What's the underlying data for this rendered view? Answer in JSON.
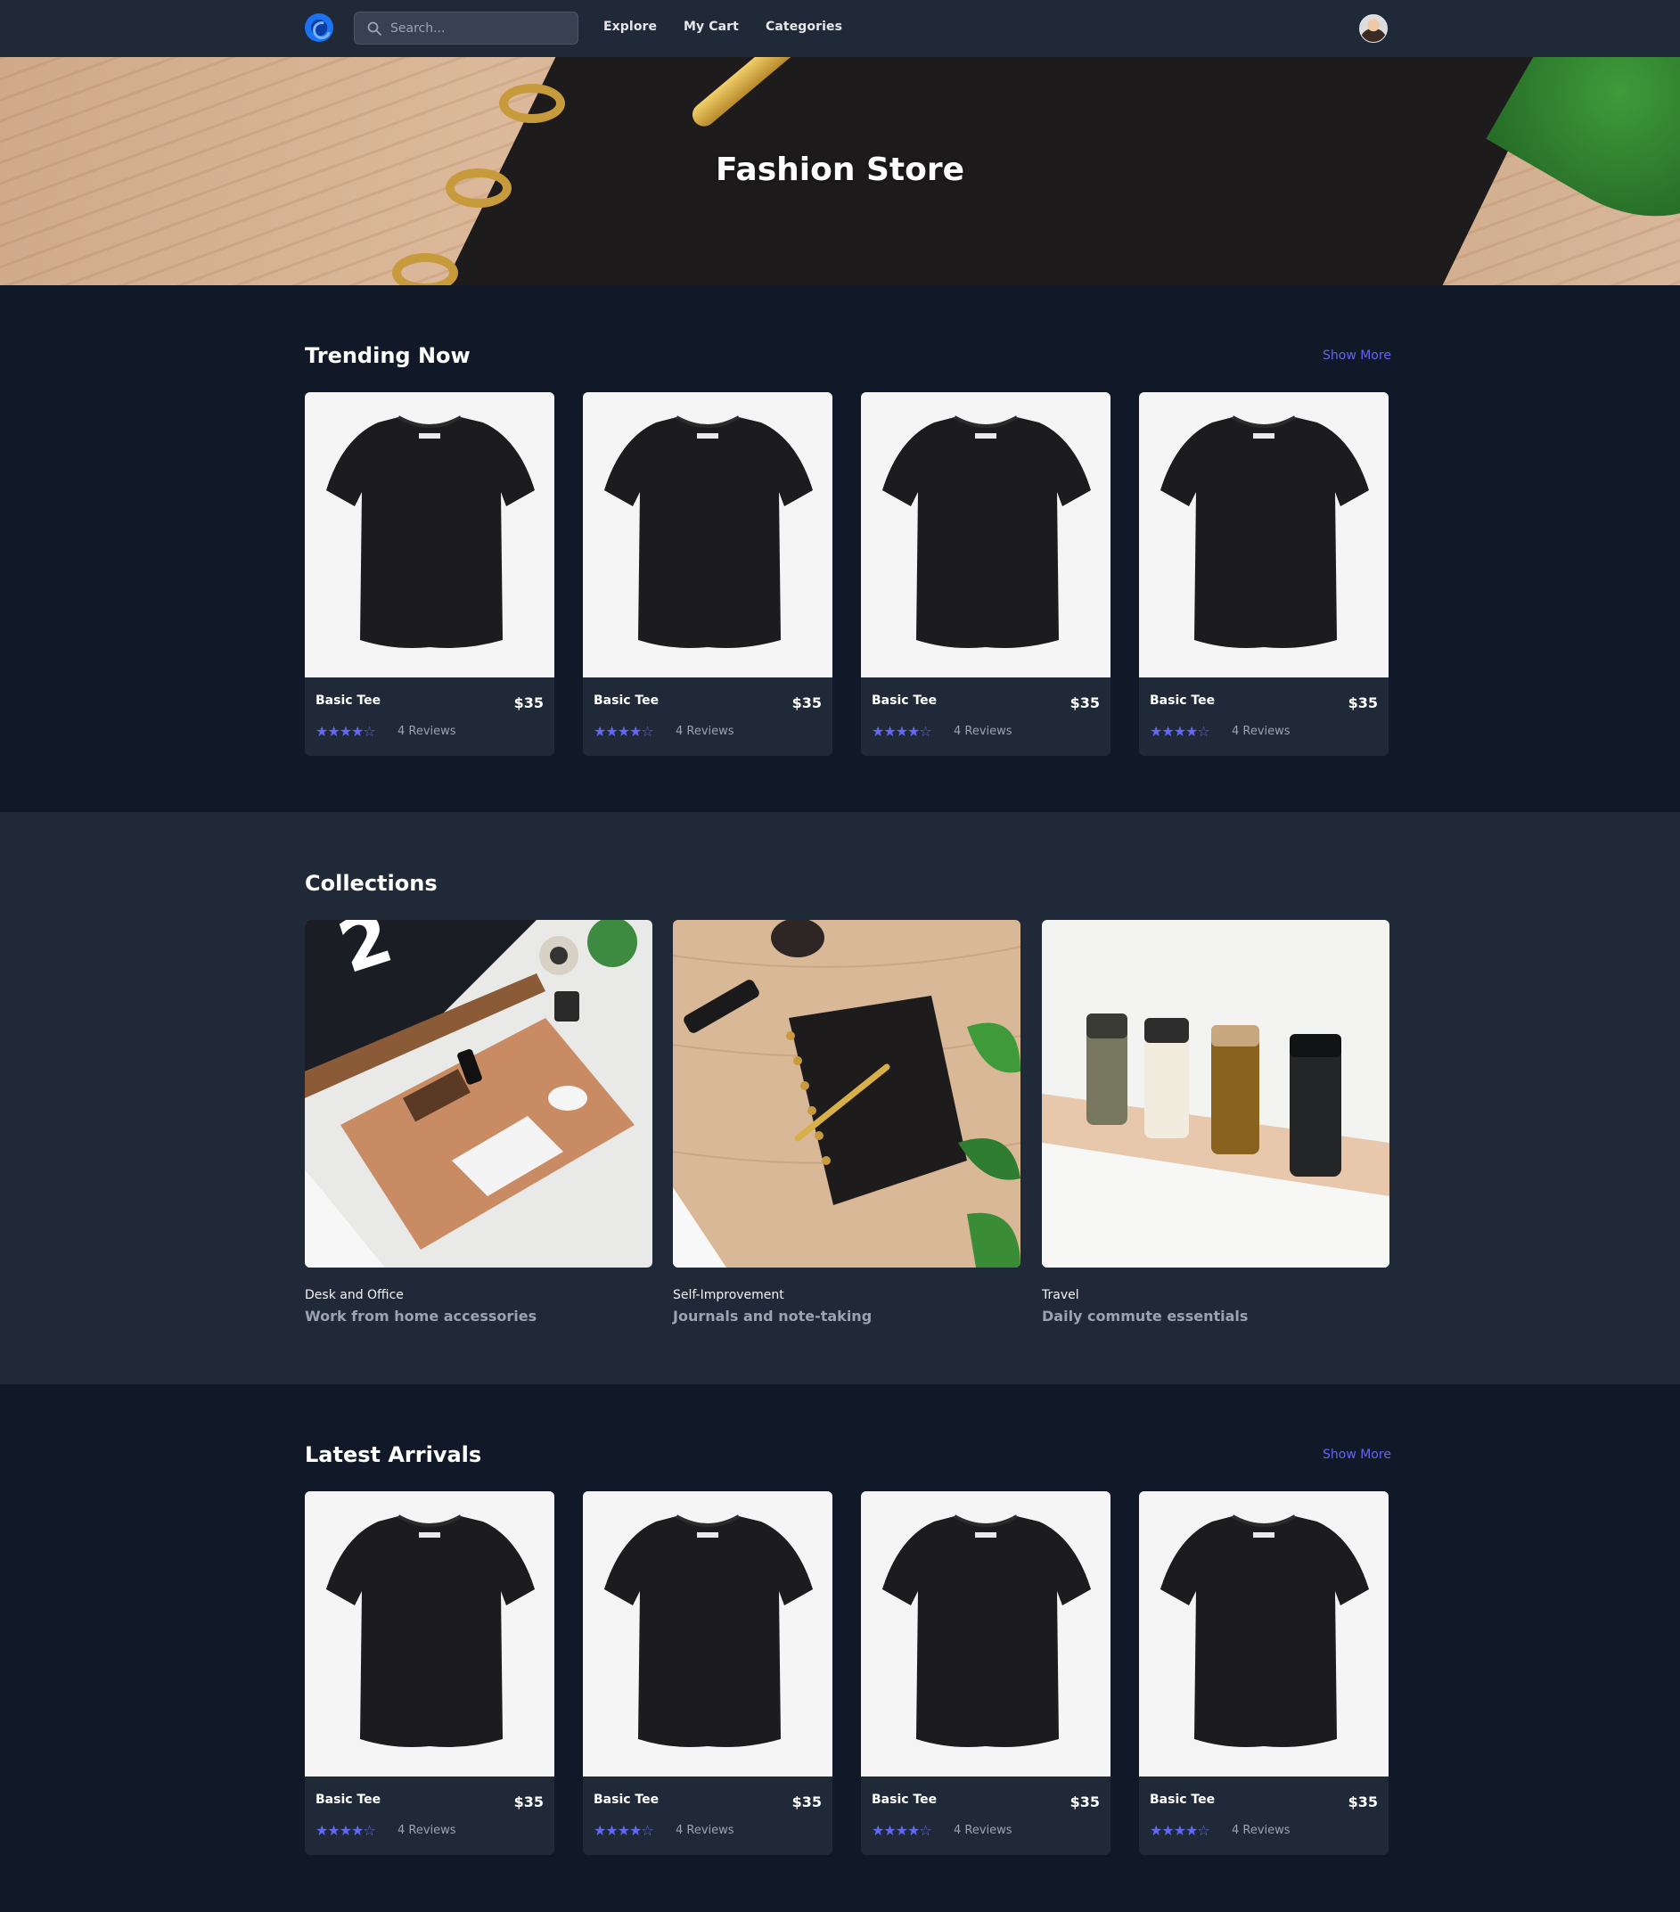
{
  "nav": {
    "search_placeholder": "Search...",
    "links": [
      "Explore",
      "My Cart",
      "Categories"
    ]
  },
  "hero": {
    "title": "Fashion Store"
  },
  "trending": {
    "title": "Trending Now",
    "show_more": "Show More",
    "products": [
      {
        "name": "Basic Tee",
        "price": "$35",
        "reviews": "4 Reviews",
        "rating": 4
      },
      {
        "name": "Basic Tee",
        "price": "$35",
        "reviews": "4 Reviews",
        "rating": 4
      },
      {
        "name": "Basic Tee",
        "price": "$35",
        "reviews": "4 Reviews",
        "rating": 4
      },
      {
        "name": "Basic Tee",
        "price": "$35",
        "reviews": "4 Reviews",
        "rating": 4
      }
    ]
  },
  "collections": {
    "title": "Collections",
    "items": [
      {
        "category": "Desk and Office",
        "title": "Work from home accessories"
      },
      {
        "category": "Self-Improvement",
        "title": "Journals and note-taking"
      },
      {
        "category": "Travel",
        "title": "Daily commute essentials"
      }
    ]
  },
  "latest": {
    "title": "Latest Arrivals",
    "show_more": "Show More",
    "products": [
      {
        "name": "Basic Tee",
        "price": "$35",
        "reviews": "4 Reviews",
        "rating": 4
      },
      {
        "name": "Basic Tee",
        "price": "$35",
        "reviews": "4 Reviews",
        "rating": 4
      },
      {
        "name": "Basic Tee",
        "price": "$35",
        "reviews": "4 Reviews",
        "rating": 4
      },
      {
        "name": "Basic Tee",
        "price": "$35",
        "reviews": "4 Reviews",
        "rating": 4
      }
    ]
  },
  "colors": {
    "accent": "#6366f1",
    "nav_bg": "#1f2937",
    "page_bg": "#111827"
  }
}
